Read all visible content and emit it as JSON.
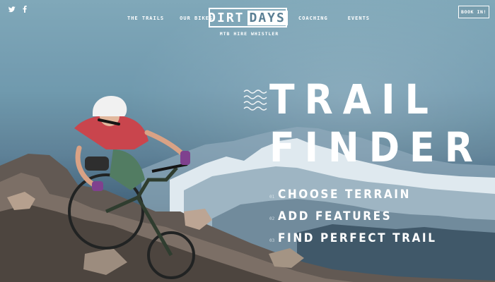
{
  "header": {
    "social": [
      {
        "icon": "twitter-icon"
      },
      {
        "icon": "facebook-icon"
      }
    ],
    "nav_left": [
      "THE TRAILS",
      "OUR BIKES"
    ],
    "nav_right": [
      "COACHING",
      "EVENTS"
    ],
    "brand": {
      "word1": "DIRT",
      "word2": "DAYS",
      "tagline": "MTB HIRE WHISTLER"
    },
    "book_button": "BOOK IN!"
  },
  "hero": {
    "title_line1": "TRAIL",
    "title_line2": "FINDER",
    "steps": [
      {
        "num": "01",
        "label": "CHOOSE TERRAIN"
      },
      {
        "num": "02",
        "label": "ADD FEATURES"
      },
      {
        "num": "03",
        "label": "FIND PERFECT TRAIL"
      }
    ]
  },
  "colors": {
    "sky": "#7ea7b8",
    "mountain": "#5b7f95",
    "text": "#ffffff",
    "jersey": "#c8424a",
    "shorts": "#4f7a5f"
  }
}
